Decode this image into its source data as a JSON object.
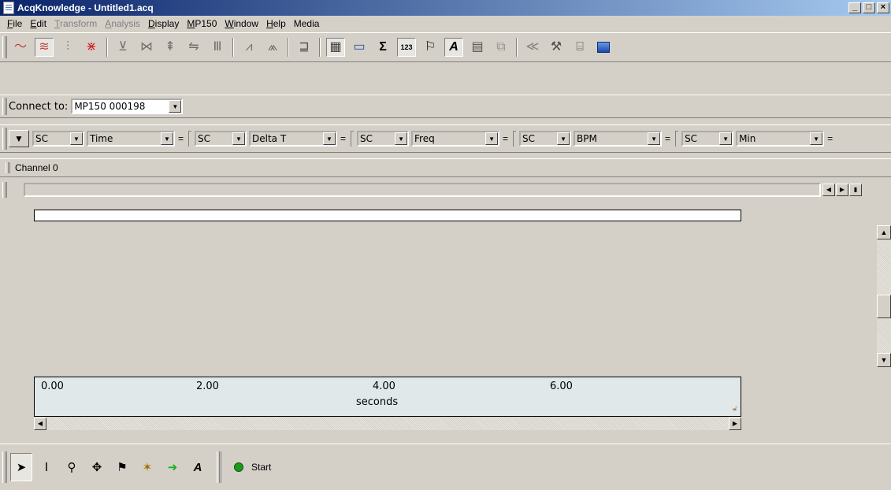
{
  "window": {
    "title": "AcqKnowledge - Untitled1.acq",
    "min_label": "_",
    "max_label": "□",
    "close_label": "×"
  },
  "menu": [
    {
      "label": "File",
      "accel": "F",
      "rest": "ile",
      "enabled": true
    },
    {
      "label": "Edit",
      "accel": "E",
      "rest": "dit",
      "enabled": true
    },
    {
      "label": "Transform",
      "accel": "T",
      "rest": "ransform",
      "enabled": false
    },
    {
      "label": "Analysis",
      "accel": "A",
      "rest": "nalysis",
      "enabled": false
    },
    {
      "label": "Display",
      "accel": "D",
      "rest": "isplay",
      "enabled": true
    },
    {
      "label": "MP150",
      "accel": "M",
      "rest": "P150",
      "enabled": true
    },
    {
      "label": "Window",
      "accel": "W",
      "rest": "indow",
      "enabled": true
    },
    {
      "label": "Help",
      "accel": "H",
      "rest": "elp",
      "enabled": true
    },
    {
      "label": "Media",
      "accel": "",
      "rest": "Media",
      "enabled": true
    }
  ],
  "connect": {
    "label": "Connect to:",
    "device": "MP150 000198"
  },
  "measurements": [
    {
      "source": "SC",
      "type": "Time"
    },
    {
      "source": "SC",
      "type": "Delta T"
    },
    {
      "source": "SC",
      "type": "Freq"
    },
    {
      "source": "SC",
      "type": "BPM"
    },
    {
      "source": "SC",
      "type": "Min"
    }
  ],
  "equals": "=",
  "channel": {
    "label": "Channel 0"
  },
  "time_axis": {
    "ticks": [
      "0.00",
      "2.00",
      "4.00",
      "6.00"
    ],
    "unit": "seconds"
  },
  "bottom": {
    "start_label": "Start"
  }
}
